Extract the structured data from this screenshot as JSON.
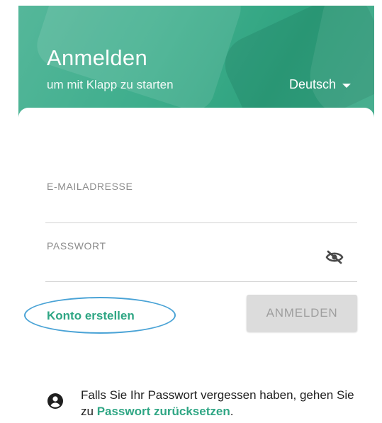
{
  "header": {
    "title": "Anmelden",
    "subtitle": "um mit Klapp zu starten",
    "language": "Deutsch"
  },
  "form": {
    "email_label": "E-MAILADRESSE",
    "email_value": "",
    "password_label": "PASSWORT",
    "password_value": "",
    "visibility_icon": "eye-off-icon"
  },
  "actions": {
    "create_account": "Konto erstellen",
    "login": "ANMELDEN"
  },
  "info": {
    "text_before": "Falls Sie Ihr Passwort vergessen haben, gehen Sie zu ",
    "reset_link": "Passwort zurücksetzen",
    "text_after": ".",
    "icon": "account-circle-icon"
  },
  "colors": {
    "brand_green": "#2fa684",
    "header_green": "#3fae8d",
    "button_disabled": "#dcdcdc",
    "highlight_ring": "#4aa3d6"
  }
}
